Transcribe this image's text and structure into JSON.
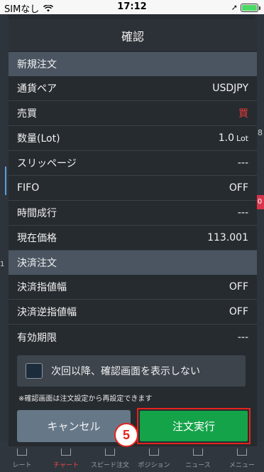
{
  "status_bar": {
    "carrier": "SIMなし",
    "time": "17:12"
  },
  "background": {
    "right_markers": [
      "8",
      "0"
    ],
    "left_marker": "1"
  },
  "tabbar": {
    "items": [
      {
        "label": "レート",
        "icon": "rate-icon"
      },
      {
        "label": "チャート",
        "icon": "chart-icon"
      },
      {
        "label": "スピード注文",
        "icon": "speed-order-icon"
      },
      {
        "label": "ポジション",
        "icon": "position-icon"
      },
      {
        "label": "ニュース",
        "icon": "news-icon"
      },
      {
        "label": "メニュー",
        "icon": "menu-icon"
      }
    ]
  },
  "dialog": {
    "title": "確認",
    "new_order": {
      "header": "新規注文",
      "rows": [
        {
          "label": "通貨ペア",
          "value": "USDJPY"
        },
        {
          "label": "売買",
          "value": "買"
        },
        {
          "label": "数量(Lot)",
          "value": "1.0",
          "unit": "Lot"
        },
        {
          "label": "スリッページ",
          "value": "---"
        },
        {
          "label": "FIFO",
          "value": "OFF"
        },
        {
          "label": "時間成行",
          "value": "---"
        },
        {
          "label": "現在価格",
          "value": "113.001"
        }
      ]
    },
    "settlement_order": {
      "header": "決済注文",
      "rows": [
        {
          "label": "決済指値幅",
          "value": "OFF"
        },
        {
          "label": "決済逆指値幅",
          "value": "OFF"
        },
        {
          "label": "有効期限",
          "value": "---"
        }
      ]
    },
    "checkbox_label": "次回以降、確認画面を表示しない",
    "checkbox_checked": false,
    "note": "※確認画面は注文設定から再設定できます",
    "cancel_label": "キャンセル",
    "execute_label": "注文実行",
    "step_badge": "5"
  },
  "colors": {
    "accent_buy": "#e73a3a",
    "execute_button": "#15a34a",
    "highlight_frame": "#e4241c"
  }
}
